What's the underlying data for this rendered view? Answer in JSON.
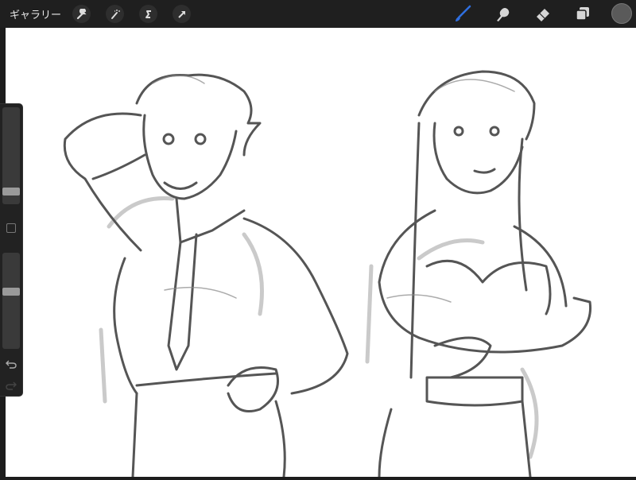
{
  "topbar": {
    "gallery_label": "ギャラリー",
    "left_tools": [
      "wrench-icon",
      "magic-wand-icon",
      "selection-icon",
      "transform-arrow-icon"
    ],
    "right_tools": [
      "brush-icon",
      "smudge-icon",
      "eraser-icon",
      "layers-icon",
      "color-swatch"
    ],
    "active_tool": "brush",
    "accent_color": "#2f6fe0",
    "current_color": "#5a5a5a"
  },
  "sidebar": {
    "brush_size": 0.1,
    "opacity": 0.6
  }
}
